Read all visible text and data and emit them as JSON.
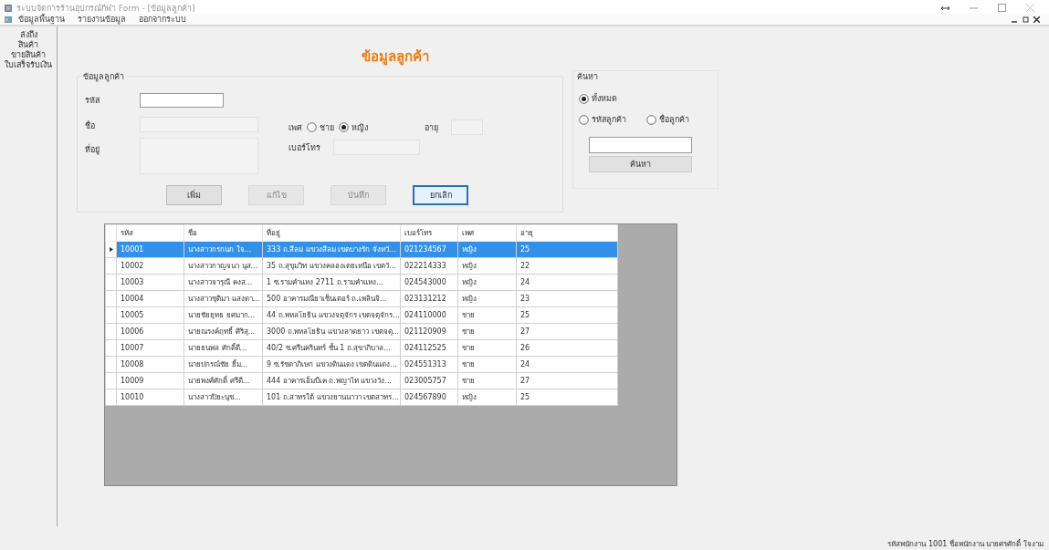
{
  "window": {
    "title": "ระบบจัดการร้านอุปกรณ์กีฬา Form - [ข้อมูลลูกค้า]"
  },
  "menu": [
    {
      "label": "ข้อมูลพื้นฐาน"
    },
    {
      "label": "รายงานข้อมูล"
    },
    {
      "label": "ออกจากระบบ"
    }
  ],
  "sidebar": {
    "items": [
      {
        "label": "ลังถึง"
      },
      {
        "label": "สินค้า"
      },
      {
        "label": "ขายสินค้า"
      },
      {
        "label": "ใบเสร็จรับเงิน"
      }
    ]
  },
  "form": {
    "title": "ข้อมูลลูกค้า",
    "group_title": "ข้อมูลลูกค้า",
    "code": {
      "label": "รหัส",
      "disabled": false
    },
    "name": {
      "label": "ชื่อ",
      "disabled": true
    },
    "address": {
      "label": "ที่อยู่",
      "disabled": true
    },
    "gender": {
      "label": "เพศ",
      "options": [
        {
          "label": "ชาย",
          "selected": false
        },
        {
          "label": "หญิง",
          "selected": true
        }
      ]
    },
    "age": {
      "label": "อายุ",
      "disabled": true
    },
    "phone": {
      "label": "เบอร์โทร",
      "disabled": true
    },
    "buttons": [
      {
        "label": "เพิ่ม",
        "disabled": false,
        "focused": false
      },
      {
        "label": "แก้ไข",
        "disabled": true,
        "focused": false
      },
      {
        "label": "บันทึก",
        "disabled": true,
        "focused": false
      },
      {
        "label": "ยกเลิก",
        "disabled": false,
        "focused": true
      }
    ]
  },
  "search": {
    "title": "ค้นหา",
    "options": [
      {
        "label": "ทั้งหมด",
        "selected": true
      },
      {
        "label": "รหัสลูกค้า",
        "selected": false
      },
      {
        "label": "ชื่อลูกค้า",
        "selected": false
      }
    ],
    "button": "ค้นหา"
  },
  "table": {
    "columns": [
      "รหัส",
      "ชื่อ",
      "ที่อยู่",
      "เบอร์โทร",
      "เพศ",
      "อายุ"
    ],
    "rows": [
      {
        "selected": true,
        "cells": [
          "10001",
          "นางสาวกรกนก ใจ...",
          "333 ถ.สีลม แขวงสีลม เขตบางรัก จังหวั...",
          "021234567",
          "หญิง",
          "25"
        ]
      },
      {
        "selected": false,
        "cells": [
          "10002",
          "นางสาวกาญจนา นุส...",
          "35 ถ.สุขุมวิท แขวงคลองเตยเหนือ เขตวั...",
          "022214333",
          "หญิง",
          "22"
        ]
      },
      {
        "selected": false,
        "cells": [
          "10003",
          "นางสาวจารุณี คงส...",
          "1 ซ.รามคำแหง 2711 ถ.รามคำแหง...",
          "024543000",
          "หญิง",
          "24"
        ]
      },
      {
        "selected": false,
        "cells": [
          "10004",
          "นางสาวชุติมา แสงดา...",
          "500 อาคารมณียาเซ็นเตอร์ ถ.เพลินจิ...",
          "023131212",
          "หญิง",
          "23"
        ]
      },
      {
        "selected": false,
        "cells": [
          "10005",
          "นายชัยยุทธ ยศมาก...",
          "44 ถ.พหลโยธิน แขวงจตุจักร เขตจตุจักร...",
          "024110000",
          "ชาย",
          "25"
        ]
      },
      {
        "selected": false,
        "cells": [
          "10006",
          "นายณรงค์ฤทธิ์ ศิริสุ...",
          "3000 ถ.พหลโยธิน แขวงลาดยาว เขตจตุ...",
          "021120909",
          "ชาย",
          "27"
        ]
      },
      {
        "selected": false,
        "cells": [
          "10007",
          "นายธนพล ศักดิ์ดี...",
          "40/2 ซ.ศรีนครินทร์ ชั้น 1 ถ.สุขาภิบาล...",
          "024112525",
          "ชาย",
          "26"
        ]
      },
      {
        "selected": false,
        "cells": [
          "10008",
          "นายปกรณ์ชัย ยิ้ม...",
          "9 ซ.รัชดาภิเษก แขวงดินแดง เขตดินแดง...",
          "024551313",
          "ชาย",
          "24"
        ]
      },
      {
        "selected": false,
        "cells": [
          "10009",
          "นายพงศ์ศักดิ์ ศรีดี...",
          "444 อาคารเอ็มบีเค ถ.พญาไท แขวงวัง...",
          "023005757",
          "ชาย",
          "27"
        ]
      },
      {
        "selected": false,
        "cells": [
          "10010",
          "นางสาวปิยะนุช...",
          "101 ถ.สาทรใต้ แขวงยานนาวา เขตสาทร...",
          "024567890",
          "หญิง",
          "25"
        ]
      }
    ]
  },
  "status_bar": {
    "text": "รหัสพนักงาน 1001 ชื่อพนักงาน นายศรศักดิ์ ใจงาม"
  }
}
